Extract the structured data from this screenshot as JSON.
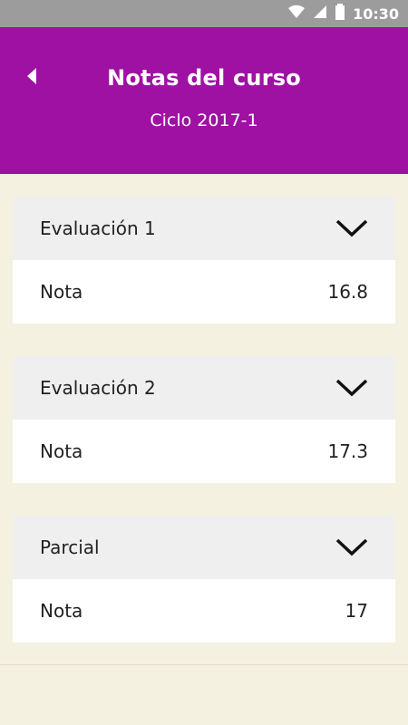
{
  "status_bar": {
    "time": "10:30",
    "icons": [
      "wifi-icon",
      "cell-signal-icon",
      "battery-icon"
    ]
  },
  "header": {
    "title": "Notas del curso",
    "subtitle": "Ciclo 2017-1",
    "back_icon": "back-arrow-icon"
  },
  "evaluations": [
    {
      "name": "Evaluación 1",
      "row_label": "Nota",
      "value": "16.8"
    },
    {
      "name": "Evaluación 2",
      "row_label": "Nota",
      "value": "17.3"
    },
    {
      "name": "Parcial",
      "row_label": "Nota",
      "value": "17"
    }
  ],
  "colors": {
    "header": "#9e11a3",
    "background": "#f4f1e1",
    "card_header": "#efefef",
    "status_bar": "#9c9c9c"
  }
}
